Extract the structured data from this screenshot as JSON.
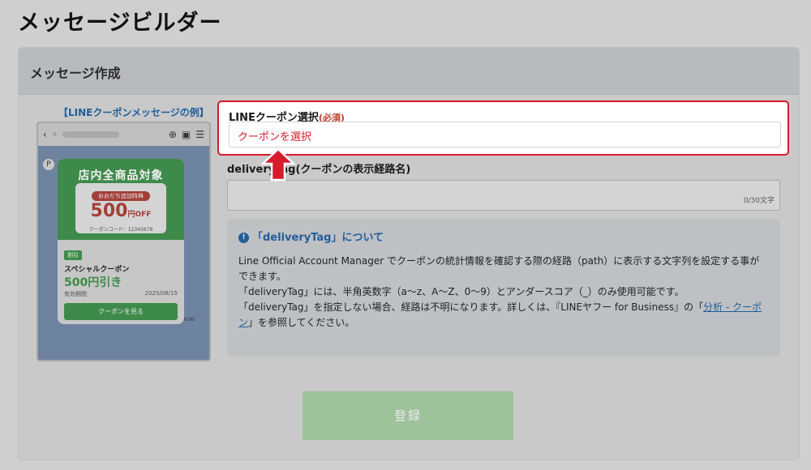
{
  "page": {
    "title": "メッセージビルダー"
  },
  "card": {
    "header": "メッセージ作成"
  },
  "preview": {
    "label": "【LINEクーポンメッセージの例】",
    "coupon": {
      "headline": "店内全商品対象",
      "ribbon": "おおだち追加特典",
      "amount": "500",
      "amount_unit": "円OFF",
      "amount_suffix": "クーポン",
      "code": "クーポンコード：12345678",
      "tag": "割引",
      "name": "スペシャルクーポン",
      "price": "500円引き",
      "period_label": "有効期間",
      "period_date": "2025/08/15",
      "button": "クーポンを見る",
      "time": "0:00"
    }
  },
  "form": {
    "coupon_label": "LINEクーポン選択",
    "required": "(必須)",
    "coupon_placeholder": "クーポンを選択",
    "delivery_label": "deliveryTag(クーポンの表示経路名)",
    "delivery_counter": "0/30文字",
    "info": {
      "title": "「deliveryTag」について",
      "line1": "Line Official Account Manager でクーポンの統計情報を確認する際の経路（path）に表示する文字列を設定する事ができます。",
      "line2": "「deliveryTag」には、半角英数字（a〜z、A〜Z、0〜9）とアンダースコア（_）のみ使用可能です。",
      "line3_pre": "「deliveryTag」を指定しない場合、経路は不明になります。詳しくは、『LINEヤフー for Business』の「",
      "line3_link": "分析 - クーポン",
      "line3_post": "」を参照してください。"
    },
    "submit": "登録"
  },
  "colors": {
    "accent_red": "#d71a2c",
    "link_blue": "#1f5f9a",
    "coupon_green": "#3e8a4a"
  }
}
